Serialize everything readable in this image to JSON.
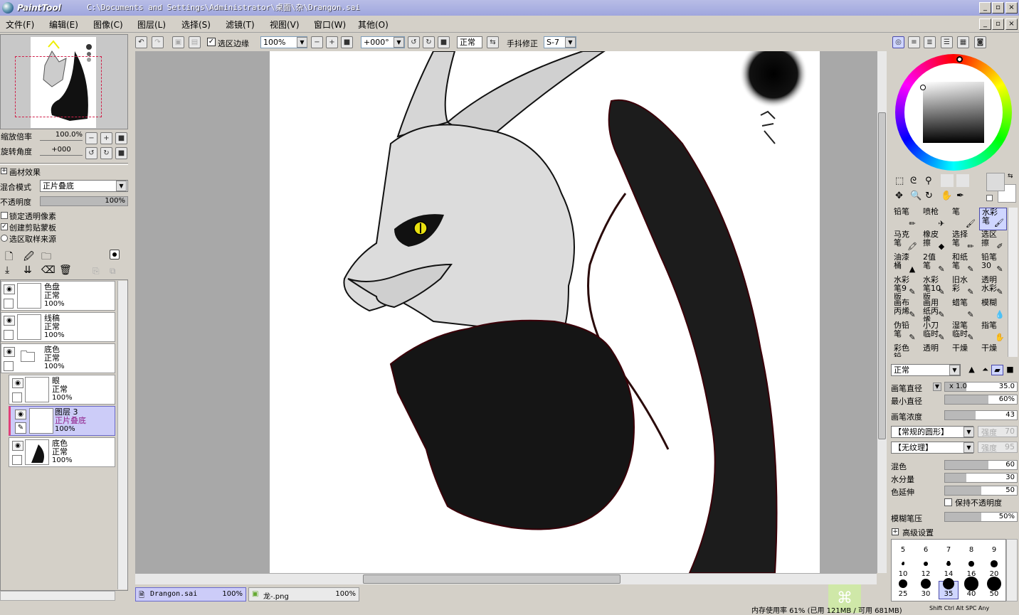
{
  "window": {
    "app_logo": "PaintTool SAI",
    "path": "C:\\Documents and Settings\\Administrator\\桌面\\杂\\Drangon.sai"
  },
  "menu": [
    "文件(F)",
    "编辑(E)",
    "图像(C)",
    "图层(L)",
    "选择(S)",
    "滤镜(T)",
    "视图(V)",
    "窗口(W)",
    "其他(O)"
  ],
  "toolbar": {
    "selection_edge_label": "选区边缘",
    "zoom_value": "100%",
    "rotate_value": "+000°",
    "blend_value": "正常",
    "stabilizer_label": "手抖修正",
    "stabilizer_value": "S-7"
  },
  "navigator": {
    "zoom_label": "缩放倍率",
    "zoom_value": "100.0%",
    "rotate_label": "旋转角度",
    "rotate_value": "+000"
  },
  "layer_props": {
    "effects_label": "画材效果",
    "blend_label": "混合模式",
    "blend_value": "正片叠底",
    "opacity_label": "不透明度",
    "opacity_value": "100%",
    "lock_alpha": "锁定透明像素",
    "clipping": "创建剪贴蒙板",
    "sel_source": "选区取样来源"
  },
  "layers": [
    {
      "name": "色盘",
      "mode": "正常",
      "opacity": "100%"
    },
    {
      "name": "线稿",
      "mode": "正常",
      "opacity": "100%"
    },
    {
      "name": "底色",
      "mode": "正常",
      "opacity": "100%"
    },
    {
      "name": "眼",
      "mode": "正常",
      "opacity": "100%"
    },
    {
      "name": "图层 3",
      "mode": "正片叠底",
      "opacity": "100%"
    },
    {
      "name": "底色",
      "mode": "正常",
      "opacity": "100%"
    }
  ],
  "tabs": [
    {
      "name": "Drangon.sai",
      "zoom": "100%"
    },
    {
      "name": "龙-.png",
      "zoom": "100%"
    }
  ],
  "tools": [
    [
      "铅笔",
      "喷枪",
      "笔",
      "水彩笔"
    ],
    [
      "马克笔",
      "橡皮擦",
      "选择笔",
      "选区擦"
    ],
    [
      "油漆桶",
      "2值笔",
      "和纸笔",
      "铅笔30"
    ],
    [
      "水彩笔9版",
      "水彩笔10版",
      "旧水彩",
      "透明水彩"
    ],
    [
      "画布丙烯",
      "画用纸丙烯",
      "蜡笔",
      "模糊"
    ],
    [
      "伪铅笔",
      "小刀临时",
      "湿笔临时",
      "指笔"
    ],
    [
      "彩色铅",
      "透明",
      "干燥",
      "干燥"
    ]
  ],
  "brush": {
    "mode": "正常",
    "size_label": "画笔直径",
    "size_mult": "x 1.0",
    "size_value": "35.0",
    "min_size_label": "最小直径",
    "min_size_value": "60%",
    "density_label": "画笔浓度",
    "density_value": "43",
    "shape_value": "【常规的圆形】",
    "shape_strength_label": "强度",
    "shape_strength": "70",
    "texture_value": "【无纹理】",
    "texture_strength_label": "强度",
    "texture_strength": "95",
    "blend_label": "混色",
    "blend_value": "60",
    "water_label": "水分量",
    "water_value": "30",
    "persist_label": "色延伸",
    "persist_value": "50",
    "keep_opacity": "保持不透明度",
    "blur_label": "模糊笔压",
    "blur_value": "50%",
    "advanced": "高级设置"
  },
  "brush_sizes": [
    "5",
    "6",
    "7",
    "8",
    "9",
    "10",
    "12",
    "14",
    "16",
    "20",
    "25",
    "30",
    "35",
    "40",
    "50"
  ],
  "status": {
    "memory": "内存使用率 61% (已用 121MB / 可用 681MB)",
    "keys": "Shift Ctrl Alt SPC Any"
  },
  "colors": {
    "accent": "#9fa6de",
    "selected_layer": "#ccccf8",
    "wing": "#1c1c1c"
  }
}
